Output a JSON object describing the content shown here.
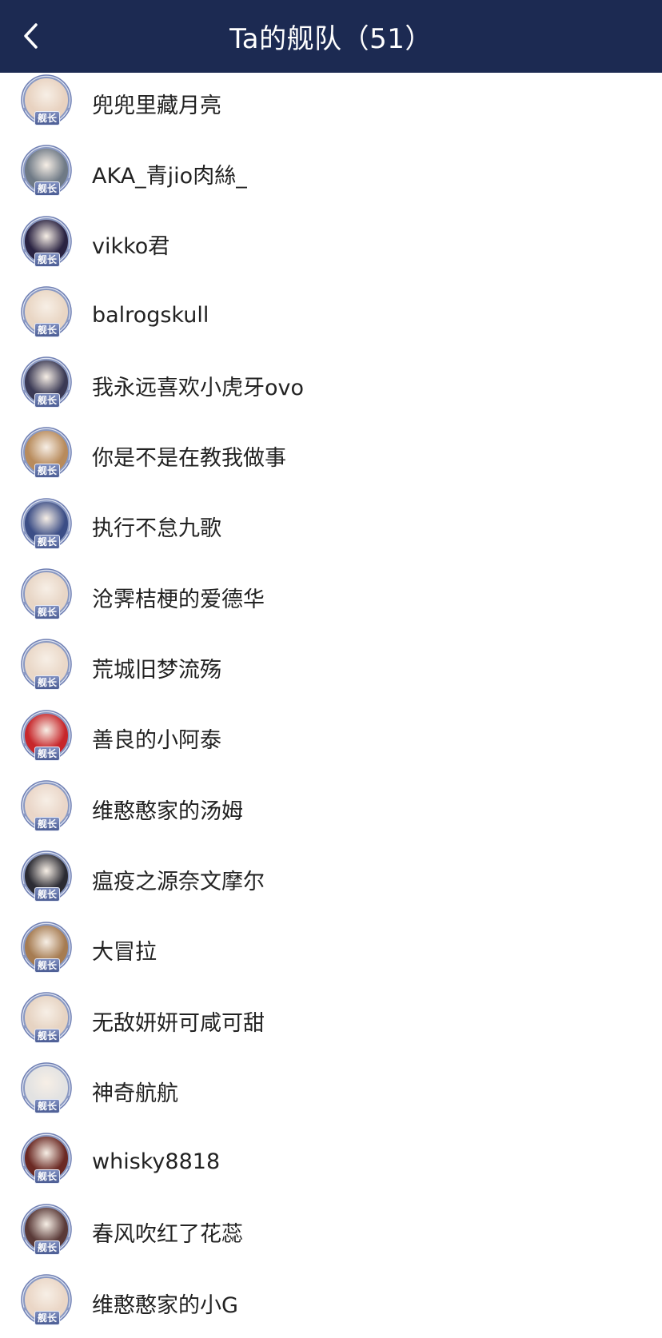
{
  "header": {
    "title": "Ta的舰队（51）",
    "back_icon": "chevron-left-icon",
    "background": "#1c2a52"
  },
  "badge_label": "舰长",
  "members": [
    {
      "name": "兜兜里藏月亮",
      "avatar_color": "#e8d2c0"
    },
    {
      "name": "AKA_青jio肉絲_",
      "avatar_color": "#6f7a86"
    },
    {
      "name": "vikko君",
      "avatar_color": "#2a2342"
    },
    {
      "name": "balrogskull",
      "avatar_color": "#e9d6c4"
    },
    {
      "name": "我永远喜欢小虎牙ovo",
      "avatar_color": "#3b3a55"
    },
    {
      "name": "你是不是在教我做事",
      "avatar_color": "#b88b5c"
    },
    {
      "name": "执行不怠九歌",
      "avatar_color": "#3c4e86"
    },
    {
      "name": "沧霁桔梗的爱德华",
      "avatar_color": "#e8d6c6"
    },
    {
      "name": "荒城旧梦流殇",
      "avatar_color": "#ead8c8"
    },
    {
      "name": "善良的小阿泰",
      "avatar_color": "#c7272b"
    },
    {
      "name": "维憨憨家的汤姆",
      "avatar_color": "#ead6c8"
    },
    {
      "name": "瘟疫之源奈文摩尔",
      "avatar_color": "#2b2b33"
    },
    {
      "name": "大冒拉",
      "avatar_color": "#a67c52"
    },
    {
      "name": "无敌妍妍可咸可甜",
      "avatar_color": "#e6d3c2"
    },
    {
      "name": "神奇航航",
      "avatar_color": "#e2e2e2"
    },
    {
      "name": "whisky8818",
      "avatar_color": "#6b2a24"
    },
    {
      "name": "春风吹红了花蕊",
      "avatar_color": "#5a3a38"
    },
    {
      "name": "维憨憨家的小G",
      "avatar_color": "#ead6c6"
    }
  ]
}
